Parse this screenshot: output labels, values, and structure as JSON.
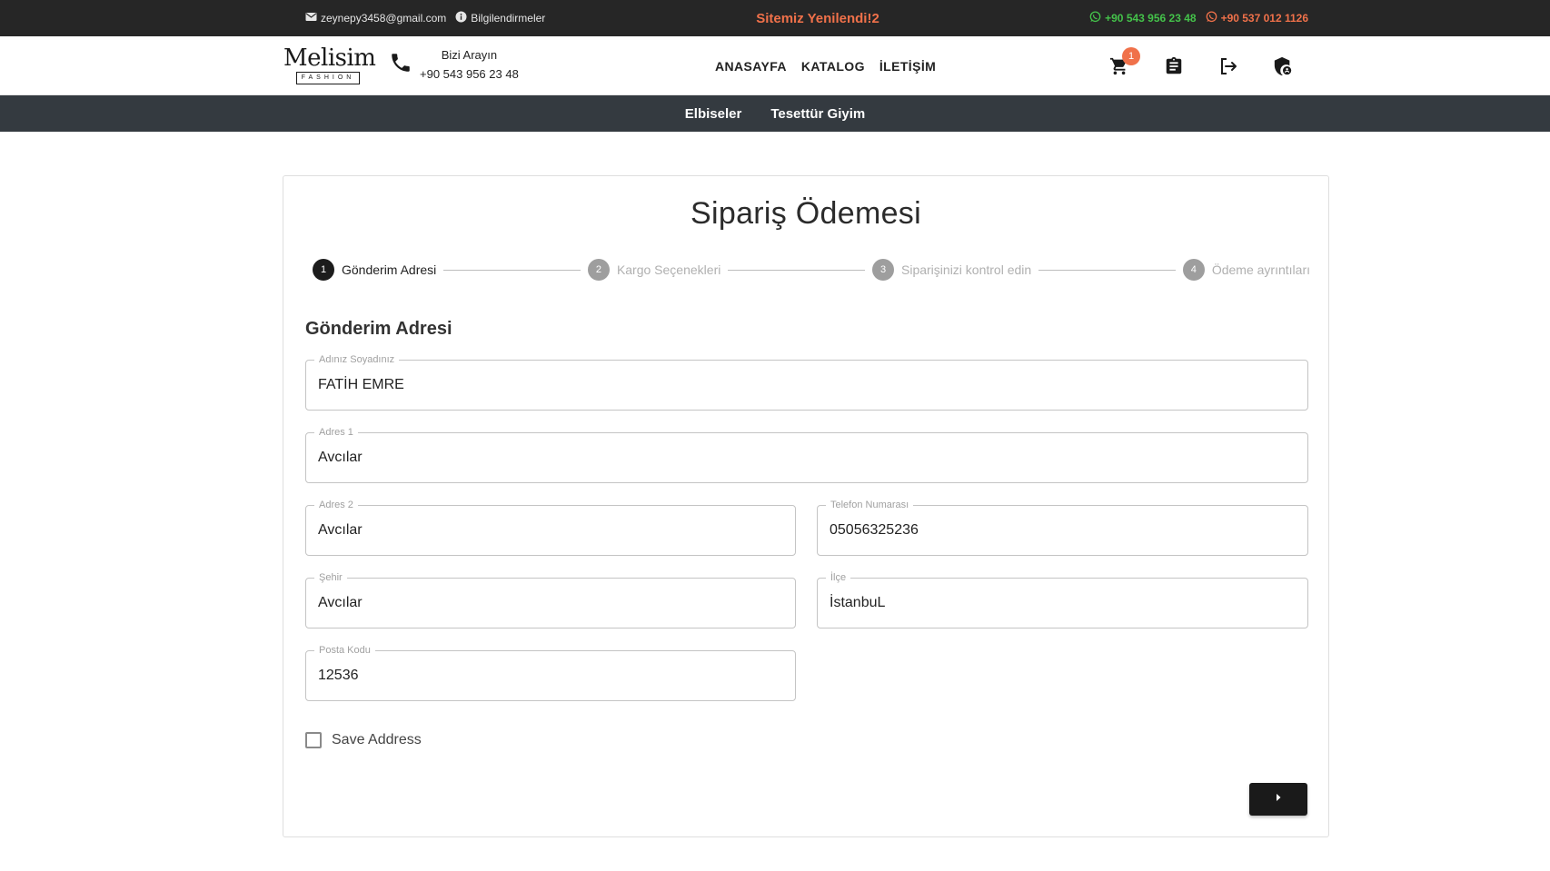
{
  "topbar": {
    "email": "zeynepy3458@gmail.com",
    "info_label": "Bilgilendirmeler",
    "announcement": "Sitemiz Yenilendi!2",
    "phone_1": "+90 543 956 23 48",
    "phone_2": "+90 537 012 1126"
  },
  "header": {
    "logo_name": "Melisim",
    "logo_tag": "FASHION",
    "call_label": "Bizi Arayın",
    "call_phone": "+90 543 956 23 48",
    "nav": [
      "ANASAYFA",
      "KATALOG",
      "İLETİŞİM"
    ],
    "cart_count": "1"
  },
  "categories": [
    "Elbiseler",
    "Tesettür Giyim"
  ],
  "checkout": {
    "title": "Sipariş Ödemesi",
    "steps": [
      {
        "num": "1",
        "label": "Gönderim Adresi"
      },
      {
        "num": "2",
        "label": "Kargo Seçenekleri"
      },
      {
        "num": "3",
        "label": "Siparişinizi kontrol edin"
      },
      {
        "num": "4",
        "label": "Ödeme ayrıntıları"
      }
    ],
    "section_title": "Gönderim Adresi",
    "fields": {
      "fullname": {
        "label": "Adınız Soyadınız",
        "value": "FATİH EMRE"
      },
      "address1": {
        "label": "Adres 1",
        "value": "Avcılar"
      },
      "address2": {
        "label": "Adres 2",
        "value": "Avcılar"
      },
      "phone": {
        "label": "Telefon Numarası",
        "value": "05056325236"
      },
      "city": {
        "label": "Şehir",
        "value": "Avcılar"
      },
      "district": {
        "label": "İlçe",
        "value": "İstanbuL"
      },
      "postal": {
        "label": "Posta Kodu",
        "value": "12536"
      }
    },
    "save_address_label": "Save Address"
  },
  "colors": {
    "topbar_bg": "#262626",
    "accent_orange": "#f0714a",
    "whatsapp_green": "#44c24a",
    "catbar_bg": "#343a40",
    "button_dark": "#1a1a1a"
  }
}
